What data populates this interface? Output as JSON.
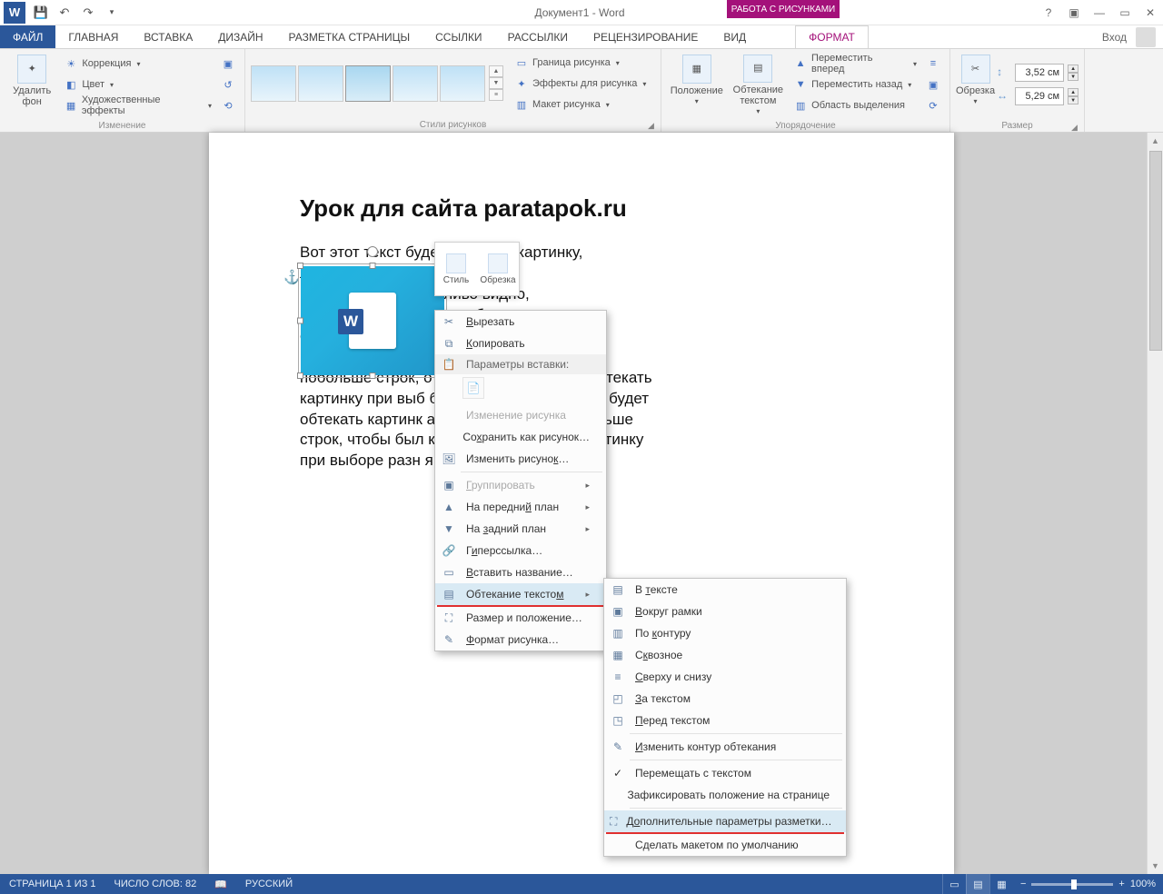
{
  "titlebar": {
    "title": "Документ1 - Word",
    "context_tab": "РАБОТА С РИСУНКАМИ",
    "login": "Вход"
  },
  "tabs": {
    "file": "ФАЙЛ",
    "home": "ГЛАВНАЯ",
    "insert": "ВСТАВКА",
    "design": "ДИЗАЙН",
    "layout": "РАЗМЕТКА СТРАНИЦЫ",
    "references": "ССЫЛКИ",
    "mailings": "РАССЫЛКИ",
    "review": "РЕЦЕНЗИРОВАНИЕ",
    "view": "ВИД",
    "format": "ФОРМАТ"
  },
  "ribbon": {
    "grp_adjust": {
      "label": "Изменение",
      "remove_bg": "Удалить фон",
      "corrections": "Коррекция",
      "color": "Цвет",
      "artistic": "Художественные эффекты"
    },
    "grp_styles": {
      "label": "Стили рисунков",
      "border": "Граница рисунка",
      "effects": "Эффекты для рисунка",
      "layout": "Макет рисунка"
    },
    "grp_arrange": {
      "label": "Упорядочение",
      "position": "Положение",
      "wrap": "Обтекание текстом",
      "bring_forward": "Переместить вперед",
      "send_backward": "Переместить назад",
      "selection_pane": "Область выделения"
    },
    "grp_size": {
      "label": "Размер",
      "crop": "Обрезка",
      "height": "3,52 см",
      "width": "5,29 см"
    }
  },
  "minitb": {
    "style": "Стиль",
    "crop": "Обрезка"
  },
  "doc": {
    "title": "Урок для сайта paratapok.ru",
    "body": "                                               Вот этот текст будет обтекать картинку,\n                                               ложена выше. Напишем\n                                               к, чтобы было отчётливо видно,\n                                               бтекать картинку при выборе\n                                               ов обтекания. Вот этот текст\nбудет обтекать ка                         ложена выше. Напишем\nпобольше строк,                           о видно, как они будут обтекать\nкартинку при выб                         бтекания. Вот этот текст будет\nобтекать картинк                          а выше. Напишем побольше\nстрок, чтобы был                           к они будут обтекать картинку\nпри выборе разн                            я."
  },
  "ctx1": {
    "cut": "Вырезать",
    "copy": "Копировать",
    "paste_opts": "Параметры вставки:",
    "change_pic_dis": "Изменение рисунка",
    "save_as_pic": "Сохранить как рисунок…",
    "change_pic": "Изменить рисунок…",
    "group": "Группировать",
    "bring_front": "На передний план",
    "send_back": "На задний план",
    "hyperlink": "Гиперссылка…",
    "insert_caption": "Вставить название…",
    "wrap_text": "Обтекание текстом",
    "size_pos": "Размер и положение…",
    "format_pic": "Формат рисунка…"
  },
  "ctx2": {
    "inline": "В тексте",
    "square": "Вокруг рамки",
    "tight": "По контуру",
    "through": "Сквозное",
    "top_bottom": "Сверху и снизу",
    "behind": "За текстом",
    "in_front": "Перед текстом",
    "edit_points": "Изменить контур обтекания",
    "move_with": "Перемещать с текстом",
    "fix_pos": "Зафиксировать положение на странице",
    "more_layout": "Дополнительные параметры разметки…",
    "set_default": "Сделать макетом по умолчанию"
  },
  "status": {
    "page": "СТРАНИЦА 1 ИЗ 1",
    "words": "ЧИСЛО СЛОВ: 82",
    "lang": "РУССКИЙ",
    "zoom": "100%"
  }
}
